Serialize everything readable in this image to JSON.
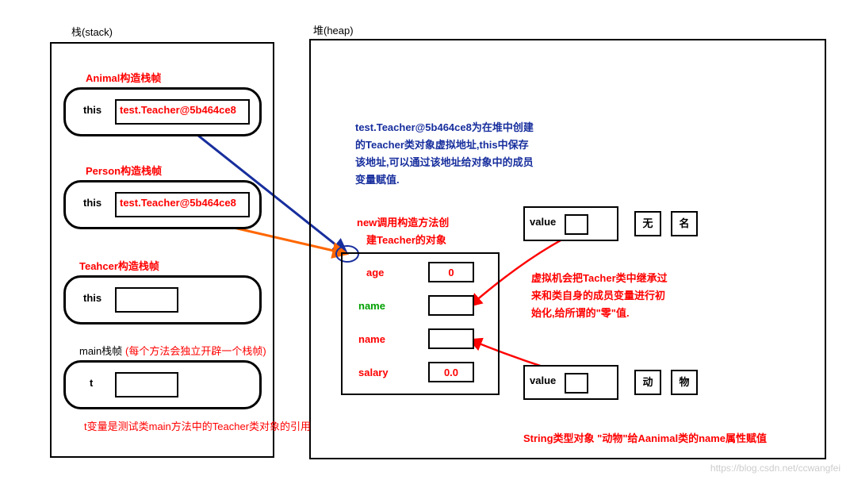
{
  "titles": {
    "stack": "栈(stack)",
    "heap": "堆(heap)"
  },
  "stack": {
    "frame1_title": "Animal构造栈帧",
    "frame2_title": "Person构造栈帧",
    "frame3_title": "Teahcer构造栈帧",
    "frame4_title": "main栈帧",
    "frame4_note": "(每个方法会独立开辟一个栈帧)",
    "this_label": "this",
    "t_label": "t",
    "this_value": "test.Teacher@5b464ce8",
    "t_note": "t变量是测试类main方法中的Teacher类对象的引用"
  },
  "heap": {
    "explain": "test.Teacher@5b464ce8为在堆中创建的Teacher类对象虚拟地址,this中保存该地址,可以通过该地址给对象中的成员变量赋值.",
    "new_note_l1": "new调用构造方法创",
    "new_note_l2": "建Teacher的对象",
    "fields": {
      "age_label": "age",
      "age_value": "0",
      "name1_label": "name",
      "name2_label": "name",
      "salary_label": "salary",
      "salary_value": "0.0"
    },
    "zero_note": "虚拟机会把Tacher类中继承过来和类自身的成员变量进行初始化,给所谓的\"零\"值.",
    "string_note": "String类型对象 \"动物\"给Aanimal类的name属性赋值",
    "value_label": "value",
    "string1_c1": "无",
    "string1_c2": "名",
    "string2_c1": "动",
    "string2_c2": "物"
  },
  "watermark": "https://blog.csdn.net/ccwangfei"
}
